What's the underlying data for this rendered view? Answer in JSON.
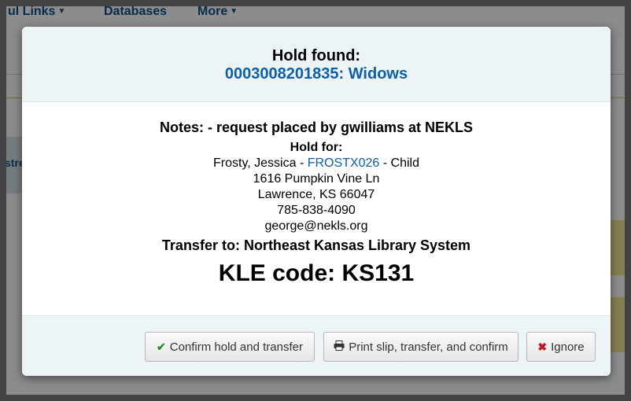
{
  "background": {
    "nav": [
      "ul Links",
      "Databases",
      "More"
    ],
    "side_text": "stre"
  },
  "modal": {
    "header": {
      "label": "Hold found:",
      "item": "0003008201835: Widows"
    },
    "body": {
      "notes": "Notes: - request placed by gwilliams at NEKLS",
      "hold_for_label": "Hold for:",
      "patron_name": "Frosty, Jessica",
      "patron_sep1": " - ",
      "patron_card": "FROSTX026",
      "patron_sep2": " - ",
      "patron_category": "Child",
      "address1": "1616 Pumpkin Vine Ln",
      "address2": "Lawrence, KS 66047",
      "phone": "785-838-4090",
      "email": "george@nekls.org",
      "transfer": "Transfer to: Northeast Kansas Library System",
      "kle_code": "KLE code: KS131"
    },
    "footer": {
      "confirm_label": "Confirm hold and transfer",
      "print_label": "Print slip, transfer, and confirm",
      "ignore_label": "Ignore"
    }
  },
  "icons": {
    "confirm": "check-icon",
    "print": "print-icon",
    "ignore": "close-icon"
  }
}
